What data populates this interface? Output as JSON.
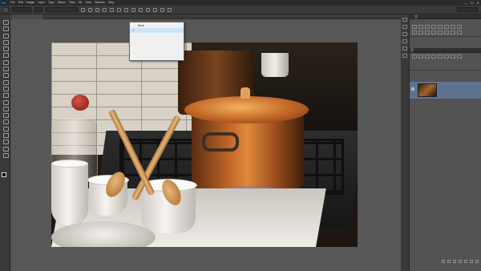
{
  "app": {
    "logo": "Ps"
  },
  "menubar": {
    "items": [
      "File",
      "Edit",
      "Image",
      "Layer",
      "Type",
      "Select",
      "Filter",
      "3D",
      "View",
      "Window",
      "Help"
    ]
  },
  "window_controls": {
    "minimize": "—",
    "maximize": "☐",
    "close": "✕"
  },
  "options_bar": {
    "field_1": "",
    "field_2": "",
    "workspace": ""
  },
  "document": {
    "tab_label": ""
  },
  "dropdown": {
    "items": [
      {
        "label": "None",
        "selected": false,
        "checked": false
      },
      {
        "label": "",
        "selected": true,
        "checked": true
      },
      {
        "label": "",
        "selected": false,
        "checked": false
      },
      {
        "label": "",
        "selected": false,
        "checked": false
      },
      {
        "label": "",
        "selected": false,
        "checked": false
      },
      {
        "label": "",
        "selected": false,
        "checked": false
      },
      {
        "label": "",
        "selected": false,
        "checked": false
      }
    ]
  },
  "right_panel": {
    "top_tabs": [
      "",
      ""
    ],
    "section_1": "",
    "layer_tabs": [
      "",
      "",
      ""
    ],
    "layer_name": ""
  },
  "colors": {
    "foreground": "#000000",
    "background": "#ffffff",
    "layer_selection": "#5e7390",
    "dropdown_highlight": "#cfe3f7"
  }
}
